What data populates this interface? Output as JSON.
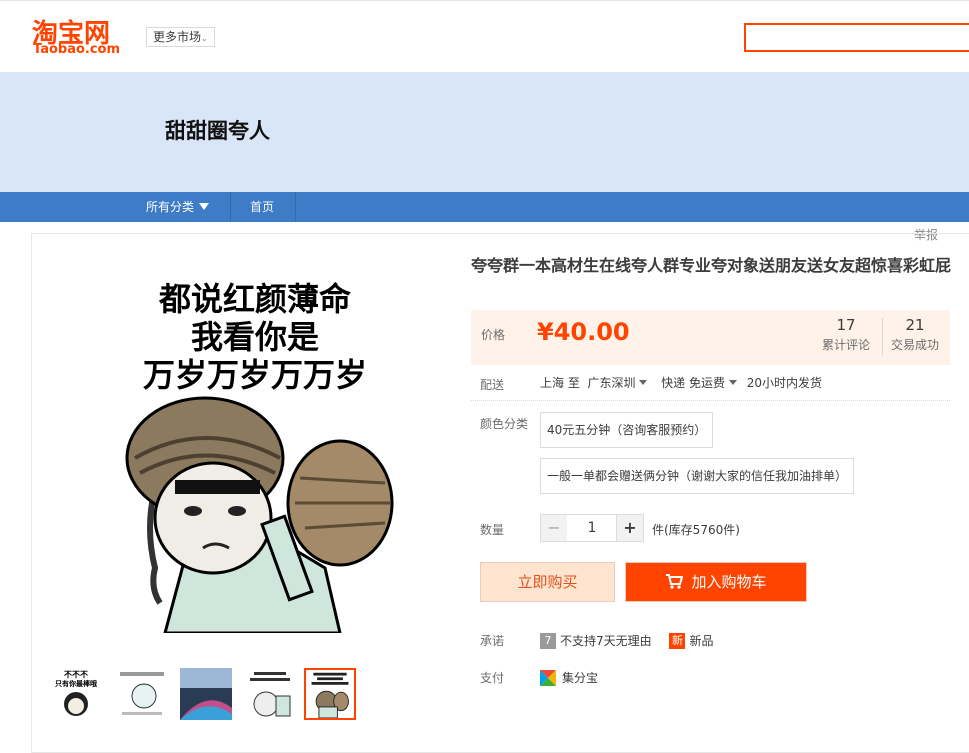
{
  "header": {
    "logo_cn": "淘宝网",
    "logo_en": "Taobao.com",
    "more_market_label": "更多市场",
    "search_placeholder": ""
  },
  "shop": {
    "name": "甜甜圈夸人"
  },
  "nav": {
    "items": [
      {
        "label": "所有分类"
      },
      {
        "label": "首页"
      }
    ]
  },
  "report_label": "举报",
  "product": {
    "title": "夸夸群一本高材生在线夸人群专业夸对象送朋友送女友超惊喜彩虹屁",
    "main_image_caption": [
      "都说红颜薄命",
      "我看你是",
      "万岁万岁万万岁"
    ],
    "price_label": "价格",
    "price": "¥40.00",
    "reviews_count": "17",
    "reviews_label": "累计评论",
    "deals_count": "21",
    "deals_label": "交易成功",
    "shipping": {
      "label": "配送",
      "from": "上海 至",
      "to": "广东深圳",
      "method": "快递 免运费",
      "delivery_time": "20小时内发货"
    },
    "options": {
      "label": "颜色分类",
      "items": [
        "40元五分钟（咨询客服预约）",
        "一般一单都会赠送俩分钟（谢谢大家的信任我加油排单）"
      ]
    },
    "quantity": {
      "label": "数量",
      "value": "1",
      "minus": "−",
      "plus": "+",
      "stock_text": "件(库存5760件)"
    },
    "buy_now_label": "立即购买",
    "add_to_cart_label": "加入购物车",
    "promise": {
      "label": "承诺",
      "no_return_badge": "7",
      "no_return_text": "不支持7天无理由",
      "new_badge": "新",
      "new_text": "新品"
    },
    "payment": {
      "label": "支付",
      "method": "集分宝"
    },
    "thumbnail_captions": [
      "不不不",
      "只有你最棒哦"
    ]
  },
  "colors": {
    "brand_orange": "#ff4400",
    "nav_blue": "#3f7cc7",
    "banner_bg": "#d9e6f7",
    "price_bg": "#fff2e8"
  }
}
